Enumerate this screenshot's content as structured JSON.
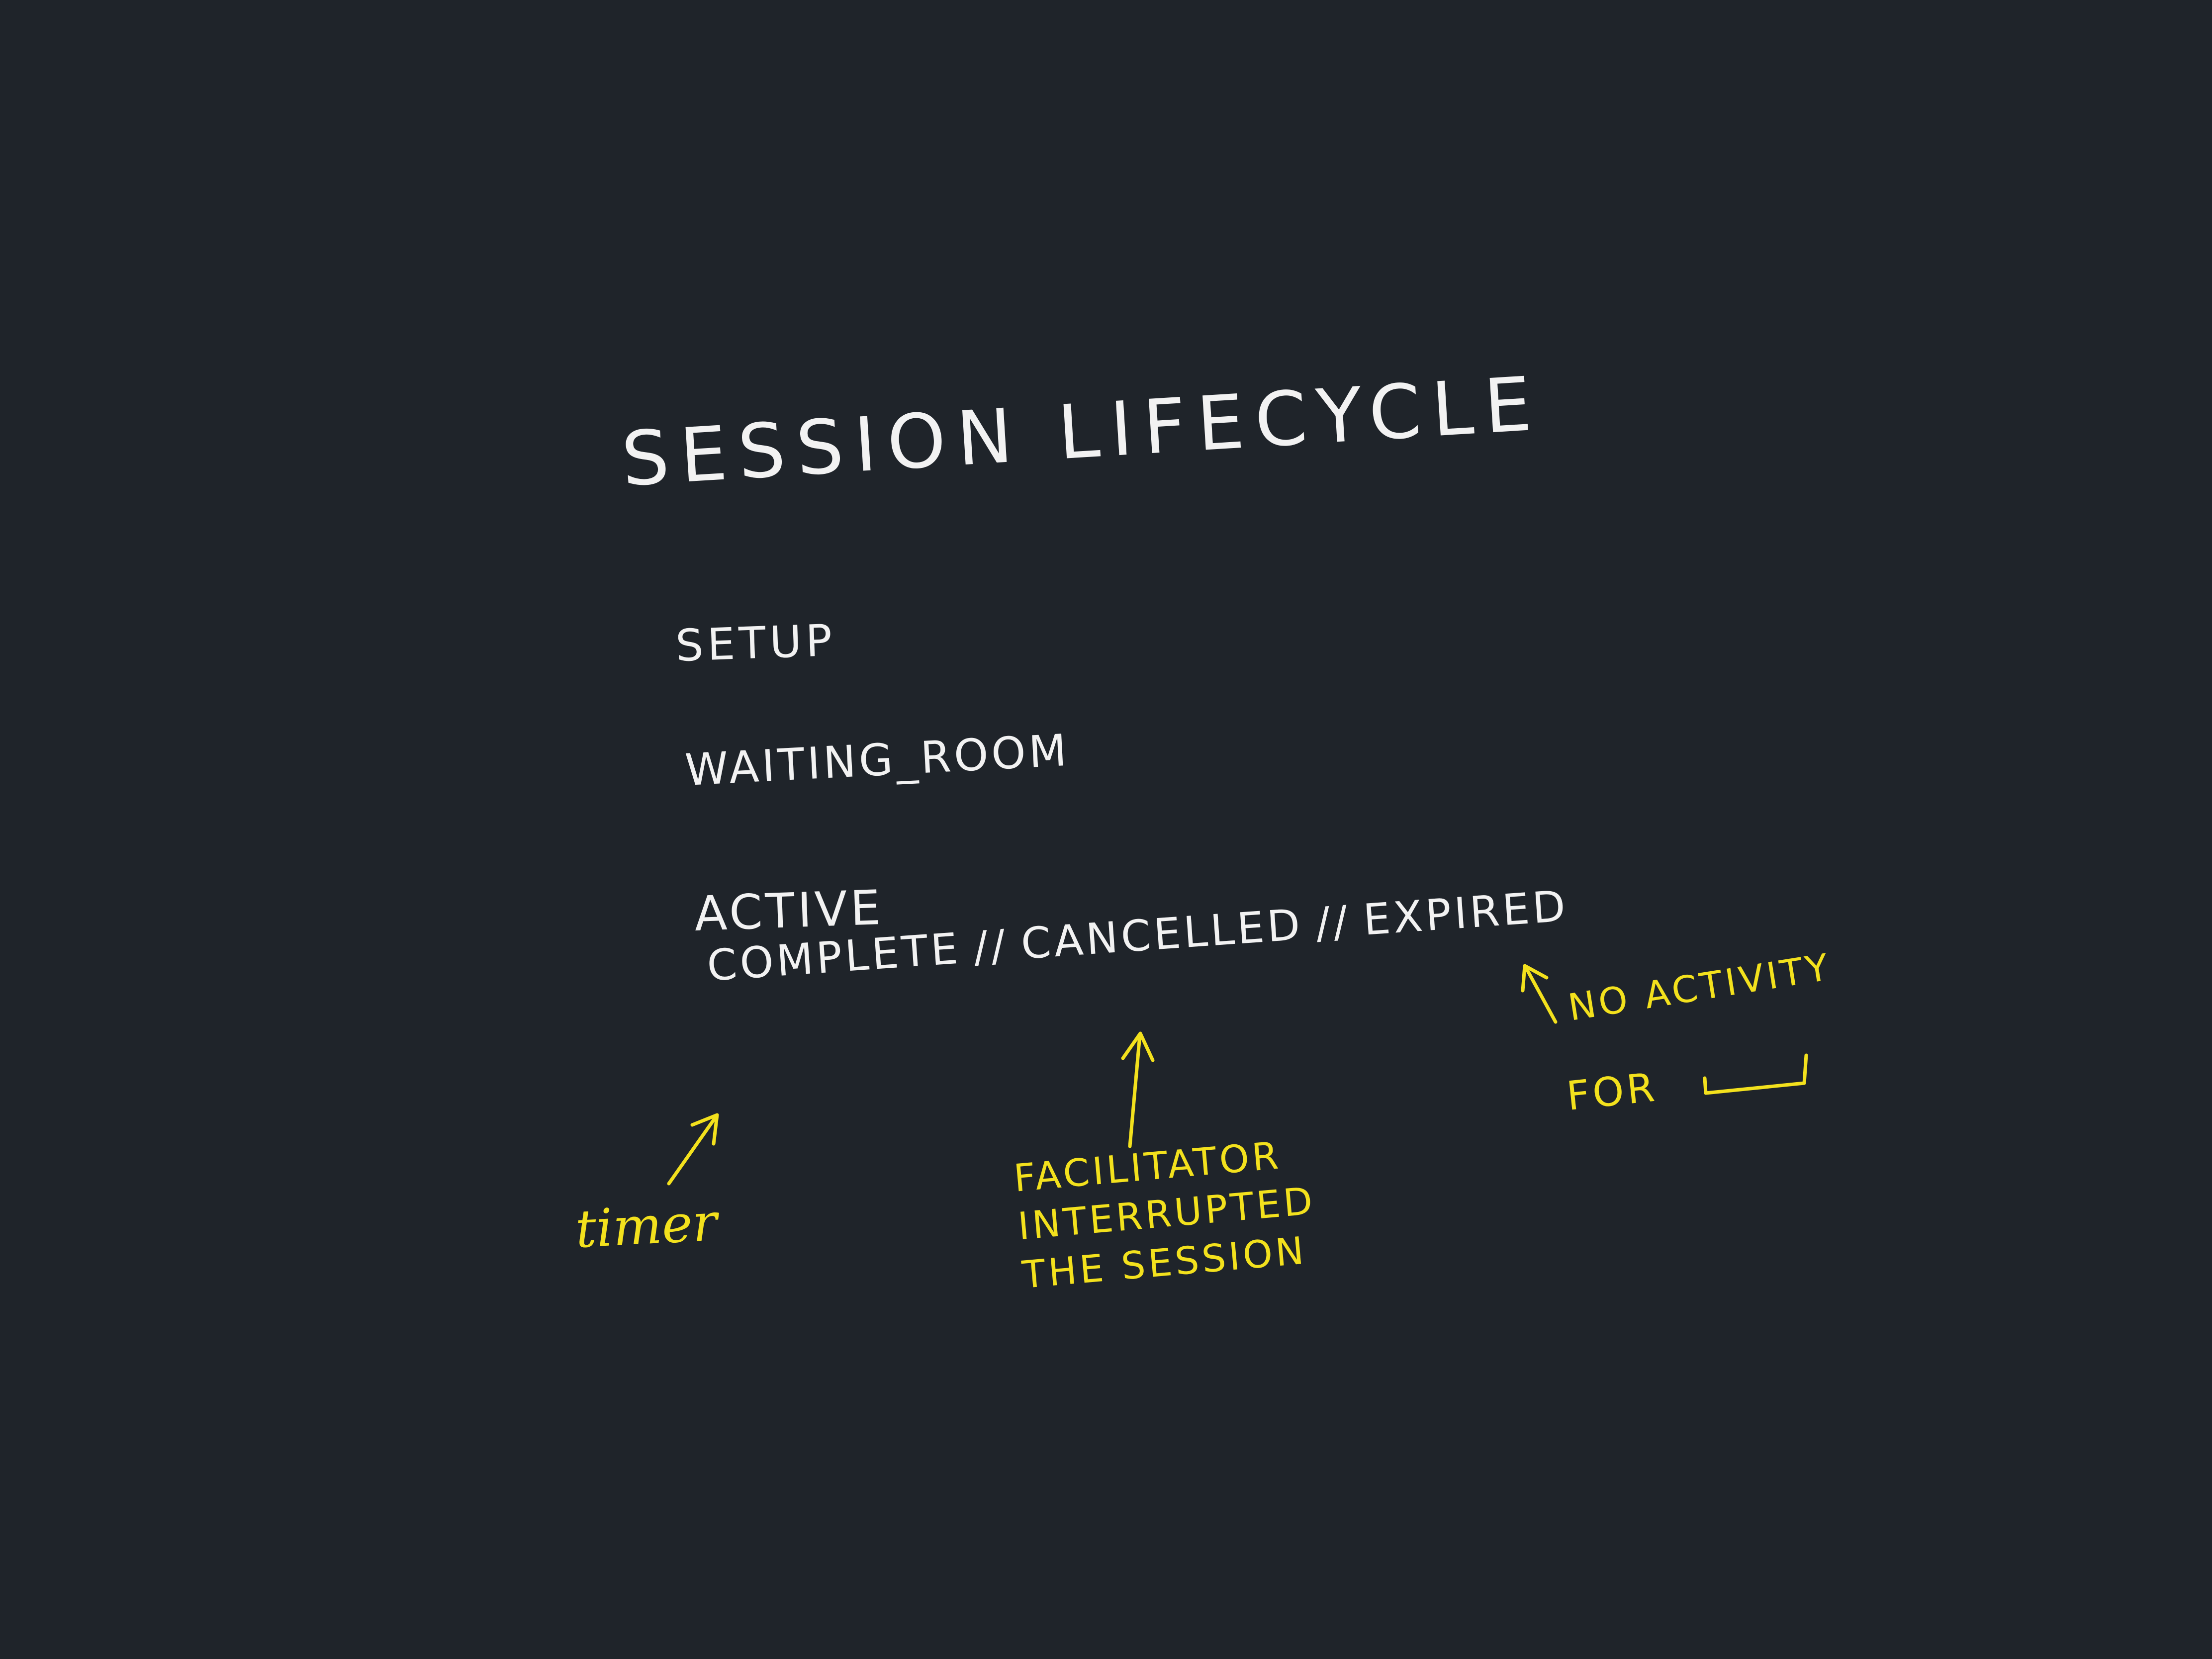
{
  "diagram": {
    "title": "SESSION LIFECYCLE",
    "states": {
      "setup": "SETUP",
      "waiting_room": "WAITING_ROOM",
      "active": "ACTIVE",
      "complete": "COMPLETE",
      "cancelled": "CANCELLED",
      "expired": "EXPIRED"
    },
    "separator": "//",
    "annotations": {
      "timer": "timer",
      "facilitator": "FACILITATOR\nINTERRUPTED\nTHE SESSION",
      "no_activity": "NO ACTIVITY",
      "for": "FOR"
    }
  },
  "colors": {
    "background": "#1f242a",
    "primary_ink": "#f2f2f2",
    "annotation_ink": "#f3e11d"
  }
}
